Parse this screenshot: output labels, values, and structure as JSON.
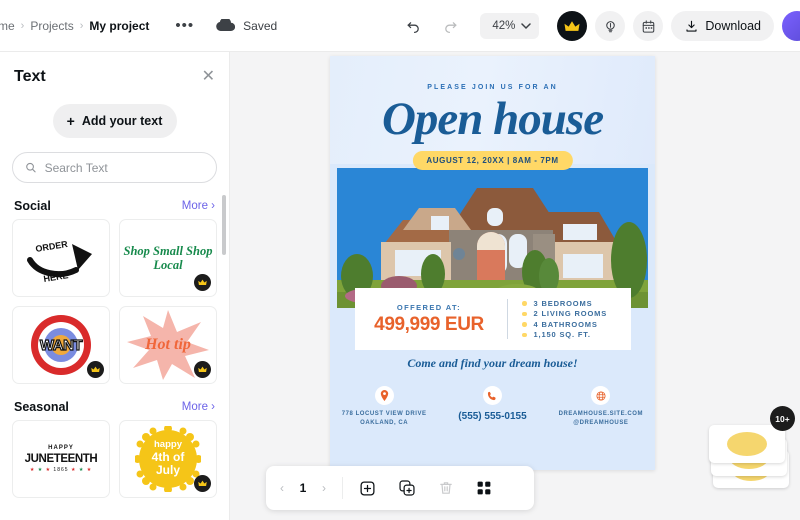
{
  "topbar": {
    "breadcrumb": [
      {
        "label": "me",
        "kind": "home"
      },
      {
        "label": "Projects",
        "kind": "link"
      },
      {
        "label": "My project",
        "kind": "current"
      }
    ],
    "more_options": "•••",
    "saved_label": "Saved",
    "undo_icon": "undo-icon",
    "redo_icon": "redo-icon",
    "zoom_value": "42%",
    "crown_icon": "crown-icon",
    "idea_icon": "lightbulb-icon",
    "calendar_icon": "calendar-icon",
    "download_label": "Download",
    "download_icon": "download-icon",
    "avatar_label": "user-avatar"
  },
  "sidebar": {
    "title": "Text",
    "close_icon": "close-icon",
    "add_text_label": "Add your text",
    "search_placeholder": "Search Text",
    "search_value": "",
    "search_icon": "search-icon",
    "sections": [
      {
        "title": "Social",
        "more_label": "More",
        "cards": [
          {
            "name": "order-here",
            "text": "ORDER HERE",
            "pro": false
          },
          {
            "name": "shop-small-shop-local",
            "text": "Shop Small Shop Local",
            "pro": true
          },
          {
            "name": "want",
            "text": "WANT",
            "pro": true
          },
          {
            "name": "hot-tip",
            "text": "Hot tip",
            "pro": true
          }
        ]
      },
      {
        "title": "Seasonal",
        "more_label": "More",
        "cards": [
          {
            "name": "juneteenth",
            "text": "HAPPY JUNETEENTH 1865",
            "pro": false
          },
          {
            "name": "fourth-of-july",
            "text": "happy 4th of July",
            "pro": true
          }
        ]
      }
    ]
  },
  "poster": {
    "eyebrow": "PLEASE JOIN US FOR AN",
    "title": "Open house",
    "date_badge": "AUGUST 12, 20XX | 8AM - 7PM",
    "photo_alt": "suburban-stone-house-photo",
    "offered_label": "OFFERED AT:",
    "price": "499,999 EUR",
    "features": [
      "3 BEDROOMS",
      "2 LIVING ROOMS",
      "4 BATHROOMS",
      "1,150 SQ. FT."
    ],
    "tagline": "Come and find your dream house!",
    "contacts": [
      {
        "icon": "location-pin-icon",
        "line1": "778 LOCUST VIEW DRIVE",
        "line2": "OAKLAND, CA",
        "style": "address"
      },
      {
        "icon": "phone-icon",
        "line1": "(555) 555-0155",
        "line2": "",
        "style": "phone"
      },
      {
        "icon": "globe-icon",
        "line1": "DREAMHOUSE.SITE.COM",
        "line2": "@DREAMHOUSE",
        "style": "web"
      }
    ],
    "colors": {
      "bg": "#dbe9fb",
      "title_blue": "#1a5c96",
      "accent_yellow": "#ffd866",
      "price_orange": "#e8622b"
    }
  },
  "bottom_toolbar": {
    "prev_icon": "chevron-left-icon",
    "page_number": "1",
    "next_icon": "chevron-right-icon",
    "add_page_icon": "add-page-icon",
    "duplicate_page_icon": "duplicate-page-icon",
    "delete_page_icon": "trash-icon",
    "grid_view_icon": "grid-view-icon"
  },
  "card_stack": {
    "badge": "10+",
    "label": "page-thumbnails-stack"
  }
}
